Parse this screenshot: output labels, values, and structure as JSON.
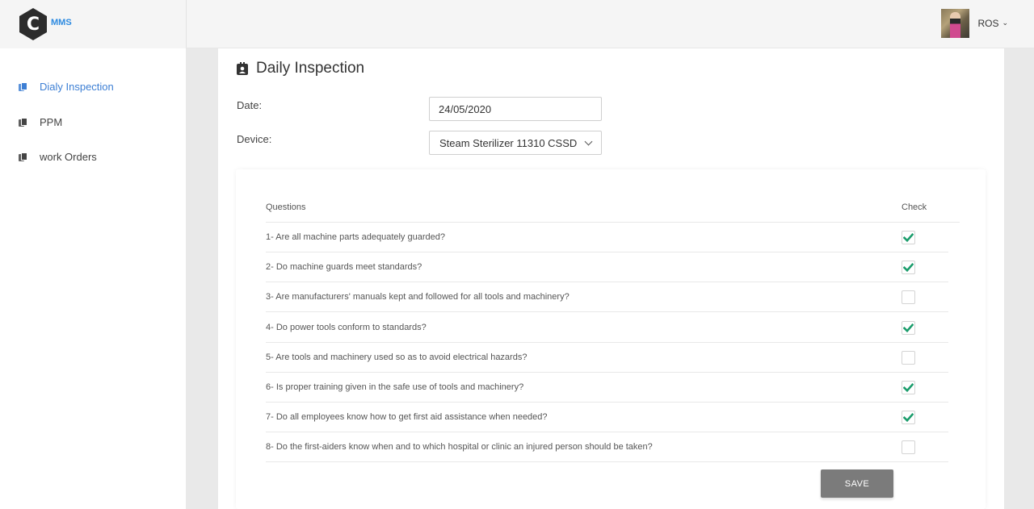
{
  "app": {
    "logo_letter": "C",
    "logo_text": "MMS"
  },
  "user": {
    "name": "ROS"
  },
  "sidebar": {
    "items": [
      {
        "label": "Dialy Inspection",
        "active": true
      },
      {
        "label": "PPM",
        "active": false
      },
      {
        "label": "work Orders",
        "active": false
      }
    ]
  },
  "page": {
    "title": "Daily Inspection",
    "date_label": "Date:",
    "date_value": "24/05/2020",
    "device_label": "Device:",
    "device_value": "Steam Sterilizer 11310 CSSD"
  },
  "table": {
    "col_questions": "Questions",
    "col_check": "Check",
    "rows": [
      {
        "text": "1- Are all machine parts adequately guarded?",
        "checked": true
      },
      {
        "text": "2- Do machine guards meet standards?",
        "checked": true
      },
      {
        "text": "3- Are manufacturers' manuals kept and followed for all tools and machinery?",
        "checked": false
      },
      {
        "text": "4- Do power tools conform to standards?",
        "checked": true
      },
      {
        "text": "5- Are tools and machinery used so as to avoid electrical hazards?",
        "checked": false
      },
      {
        "text": "6- Is proper training given in the safe use of tools and machinery?",
        "checked": true
      },
      {
        "text": "7- Do all employees know how to get first aid assistance when needed?",
        "checked": true
      },
      {
        "text": "8- Do the first-aiders know when and to which hospital or clinic an injured person should be taken?",
        "checked": false
      }
    ]
  },
  "actions": {
    "save_label": "SAVE"
  },
  "colors": {
    "accent": "#3d7fd4",
    "check": "#1a9c6b",
    "save_button": "#7b7b7b"
  }
}
